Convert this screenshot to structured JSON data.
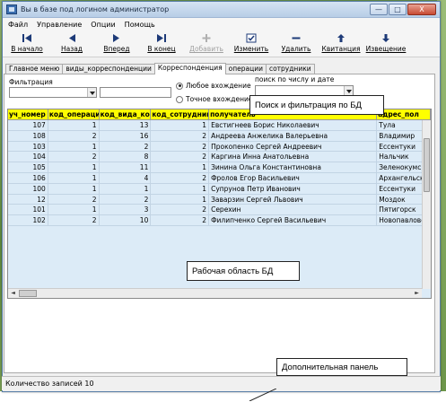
{
  "window": {
    "title": "Вы в базе под логином администратор",
    "minimize_label": "—",
    "maximize_label": "□",
    "close_label": "X"
  },
  "menu": [
    "Файл",
    "Управление",
    "Опции",
    "Помощь"
  ],
  "toolbar": [
    {
      "label": "В начало",
      "icon": "first-icon",
      "enabled": true
    },
    {
      "label": "Назад",
      "icon": "prev-icon",
      "enabled": true
    },
    {
      "label": "Вперед",
      "icon": "next-icon",
      "enabled": true
    },
    {
      "label": "В конец",
      "icon": "last-icon",
      "enabled": true
    },
    {
      "label": "Добавить",
      "icon": "add-icon",
      "enabled": false
    },
    {
      "label": "Изменить",
      "icon": "edit-icon",
      "enabled": true
    },
    {
      "label": "Удалить",
      "icon": "delete-icon",
      "enabled": true
    },
    {
      "label": "Квитанция",
      "icon": "receipt-icon",
      "enabled": true
    },
    {
      "label": "Извещение",
      "icon": "notice-icon",
      "enabled": true
    }
  ],
  "tabs": [
    {
      "label": "Главное меню",
      "active": false
    },
    {
      "label": "виды_корреспонденции",
      "active": false
    },
    {
      "label": "Корреспонденция",
      "active": true
    },
    {
      "label": "операции",
      "active": false
    },
    {
      "label": "сотрудники",
      "active": false
    }
  ],
  "filter": {
    "label": "Фильтрация",
    "combo_value": "",
    "text_value": "",
    "radio_any": "Любое вхождение",
    "radio_exact": "Точное вхождение",
    "selected": "any",
    "search_label": "поиск по числу и дате",
    "search_value": ""
  },
  "callouts": {
    "search": "Поиск и фильтрация по БД",
    "workspace": "Рабочая область БД",
    "extra": "Дополнительная панель"
  },
  "table": {
    "columns": [
      "уч_номер",
      "код_операции",
      "код_вида_кор",
      "код_сотрудника",
      "получатель",
      "адрес_пол"
    ],
    "rows": [
      [
        "107",
        "1",
        "13",
        "1",
        "Евстигнеев Борис Николаевич",
        "Тула"
      ],
      [
        "108",
        "2",
        "16",
        "2",
        "Андреева Анжелика Валерьевна",
        "Владимир"
      ],
      [
        "103",
        "1",
        "2",
        "2",
        "Прокопенко Сергей Андреевич",
        "Ессентуки"
      ],
      [
        "104",
        "2",
        "8",
        "2",
        "Каргина Инна Анатольевна",
        "Нальчик"
      ],
      [
        "105",
        "1",
        "11",
        "1",
        "Зинина Ольга Константиновна",
        "Зеленокумск"
      ],
      [
        "106",
        "1",
        "4",
        "2",
        "Фролов Егор Васильевич",
        "Архангельск"
      ],
      [
        "100",
        "1",
        "1",
        "1",
        "Супрунов Петр Иванович",
        "Ессентуки"
      ],
      [
        "12",
        "2",
        "2",
        "1",
        "Заварзин Сергей Львович",
        "Моздок"
      ],
      [
        "101",
        "1",
        "3",
        "2",
        "Серехин",
        "Пятигорск"
      ],
      [
        "102",
        "2",
        "10",
        "2",
        "Филипченко Сергей Васильевич",
        "Новопавловск"
      ]
    ]
  },
  "status": {
    "record_count": "Количество записей 10"
  }
}
